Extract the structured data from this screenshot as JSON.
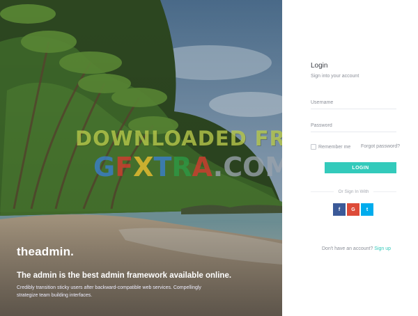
{
  "hero": {
    "brand": "theadmin.",
    "tagline": "The admin is the best admin framework available online.",
    "description": "Credibly transition sticky users after backward-compatible web services. Compellingly strategize team building interfaces."
  },
  "watermark": {
    "line1": "DOWNLOADED FROM",
    "line2": [
      "G",
      "F",
      "X",
      "T",
      "R",
      "A",
      ".COM"
    ]
  },
  "login": {
    "title": "Login",
    "subtitle": "Sign into your account",
    "username_placeholder": "Username",
    "password_placeholder": "Password",
    "remember_label": "Remember me",
    "forgot_link": "Forgot password?",
    "login_button": "LOGIN",
    "divider_text": "Or Sign In With",
    "social": [
      {
        "name": "facebook",
        "glyph": "f",
        "color": "#3b5998"
      },
      {
        "name": "google",
        "glyph": "G",
        "color": "#dd4b39"
      },
      {
        "name": "twitter",
        "glyph": "t",
        "color": "#00aced"
      }
    ],
    "signup_prompt": "Don't have an account?",
    "signup_link": "Sign up"
  },
  "colors": {
    "accent": "#33cabb"
  }
}
